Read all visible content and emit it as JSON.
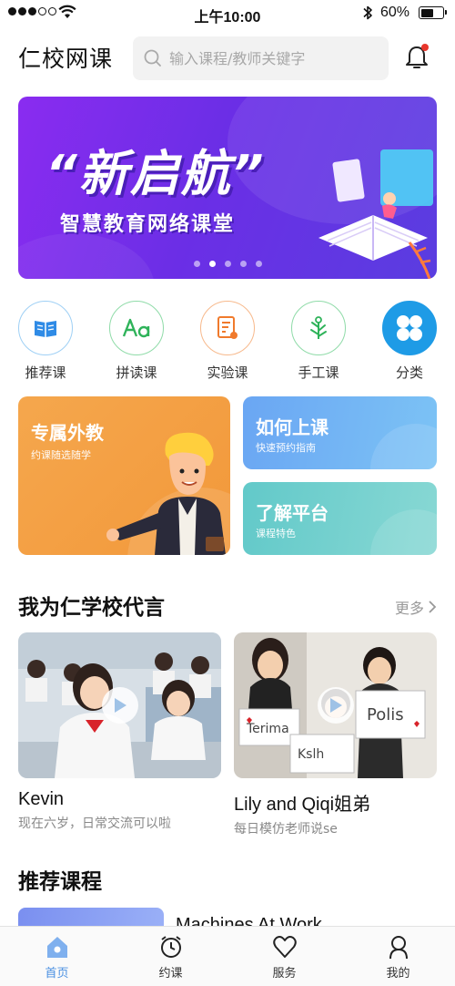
{
  "status_bar": {
    "time": "上午10:00",
    "battery": "60%",
    "battery_level": 0.6
  },
  "header": {
    "title": "仁校网课",
    "search_placeholder": "输入课程/教师关键字",
    "notification_badge_color": "#e8362c"
  },
  "banner": {
    "title": "“新启航”",
    "subtitle": "智慧教育网络课堂",
    "slide_count": 5,
    "active_slide": 2
  },
  "categories": [
    {
      "label": "推荐课",
      "icon": "book-icon",
      "color": "#2f8be6"
    },
    {
      "label": "拼读课",
      "icon": "letters-icon",
      "color": "#2fb35a"
    },
    {
      "label": "实验课",
      "icon": "experiment-icon",
      "color": "#f07a2c"
    },
    {
      "label": "手工课",
      "icon": "plant-icon",
      "color": "#2fb35a"
    },
    {
      "label": "分类",
      "icon": "grid-icon",
      "color": "#1e9be6"
    }
  ],
  "promo": {
    "teacher": {
      "title": "专属外教",
      "subtitle": "约课随选随学"
    },
    "howto": {
      "title": "如何上课",
      "subtitle": "快速预约指南"
    },
    "platform": {
      "title": "了解平台",
      "subtitle": "课程特色"
    }
  },
  "spokes": {
    "title": "我为仁学校代言",
    "more": "更多",
    "videos": [
      {
        "name": "Kevin",
        "desc": "现在六岁，日常交流可以啦"
      },
      {
        "name": "Lily and Qiqi姐弟",
        "desc": "每日模仿老师说se"
      }
    ]
  },
  "recommended": {
    "title": "推荐课程",
    "first_course": "Machines At Work"
  },
  "tabbar": {
    "tabs": [
      {
        "label": "首页",
        "icon": "home-icon",
        "active": true
      },
      {
        "label": "约课",
        "icon": "alarm-clock-icon",
        "active": false
      },
      {
        "label": "服务",
        "icon": "heart-icon",
        "active": false
      },
      {
        "label": "我的",
        "icon": "user-icon",
        "active": false
      }
    ],
    "active_color": "#4a90e2"
  }
}
